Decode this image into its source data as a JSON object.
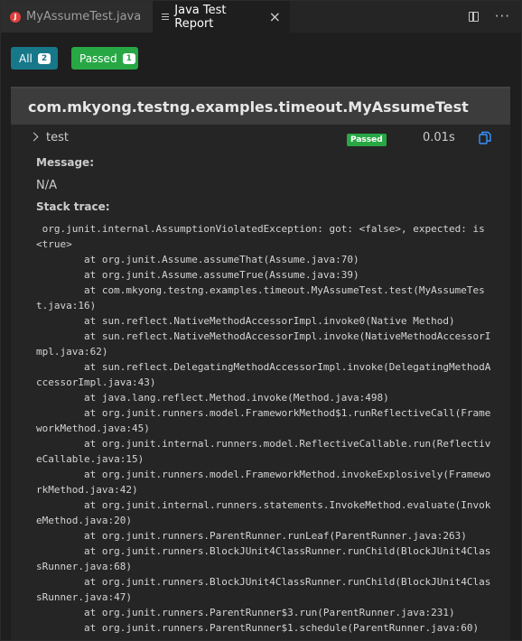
{
  "tabs": [
    {
      "label": "MyAssumeTest.java",
      "icon": "java-file-icon",
      "icon_glyph": "J",
      "active": false
    },
    {
      "label": "Java Test Report",
      "icon": "report-icon",
      "active": true
    }
  ],
  "filters": {
    "all_label": "All",
    "all_count": "2",
    "passed_label": "Passed",
    "passed_count": "1"
  },
  "suite": {
    "title": "com.mkyong.testng.examples.timeout.MyAssumeTest",
    "test": {
      "name": "test",
      "status": "Passed",
      "duration": "0.01s",
      "message_label": "Message:",
      "message_value": "N/A",
      "trace_label": "Stack trace:",
      "trace": " org.junit.internal.AssumptionViolatedException: got: <false>, expected: is <true>\n        at org.junit.Assume.assumeThat(Assume.java:70)\n        at org.junit.Assume.assumeTrue(Assume.java:39)\n        at com.mkyong.testng.examples.timeout.MyAssumeTest.test(MyAssumeTest.java:16)\n        at sun.reflect.NativeMethodAccessorImpl.invoke0(Native Method)\n        at sun.reflect.NativeMethodAccessorImpl.invoke(NativeMethodAccessorImpl.java:62)\n        at sun.reflect.DelegatingMethodAccessorImpl.invoke(DelegatingMethodAccessorImpl.java:43)\n        at java.lang.reflect.Method.invoke(Method.java:498)\n        at org.junit.runners.model.FrameworkMethod$1.runReflectiveCall(FrameworkMethod.java:45)\n        at org.junit.internal.runners.model.ReflectiveCallable.run(ReflectiveCallable.java:15)\n        at org.junit.runners.model.FrameworkMethod.invokeExplosively(FrameworkMethod.java:42)\n        at org.junit.internal.runners.statements.InvokeMethod.evaluate(InvokeMethod.java:20)\n        at org.junit.runners.ParentRunner.runLeaf(ParentRunner.java:263)\n        at org.junit.runners.BlockJUnit4ClassRunner.runChild(BlockJUnit4ClassRunner.java:68)\n        at org.junit.runners.BlockJUnit4ClassRunner.runChild(BlockJUnit4ClassRunner.java:47)\n        at org.junit.runners.ParentRunner$3.run(ParentRunner.java:231)\n        at org.junit.runners.ParentRunner$1.schedule(ParentRunner.java:60)"
    }
  },
  "colors": {
    "all_button": "#17788a",
    "passed_button": "#28a745",
    "java_icon": "#e0403c",
    "copy_icon": "#3794ff"
  }
}
